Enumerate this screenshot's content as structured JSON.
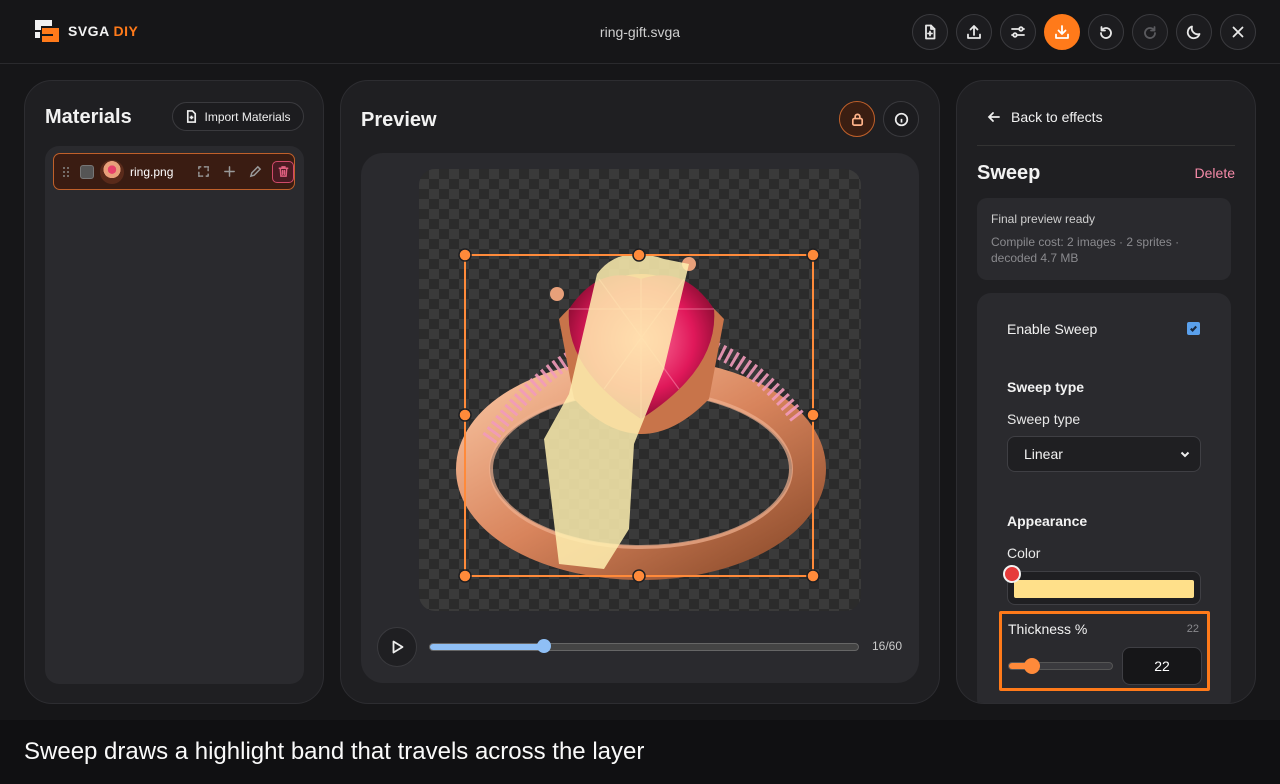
{
  "app": {
    "logo_primary": "SVGA",
    "logo_accent": "DIY",
    "file_name": "ring-gift.svga",
    "accent_color": "#ff7a1a"
  },
  "toolbar": {
    "buttons": [
      {
        "name": "new-file",
        "icon": "file-plus-icon"
      },
      {
        "name": "upload",
        "icon": "upload-icon"
      },
      {
        "name": "settings",
        "icon": "sliders-icon"
      },
      {
        "name": "download",
        "icon": "download-icon",
        "primary": true
      },
      {
        "name": "undo",
        "icon": "undo-icon"
      },
      {
        "name": "redo",
        "icon": "redo-icon",
        "disabled": true
      },
      {
        "name": "theme",
        "icon": "moon-icon"
      },
      {
        "name": "close",
        "icon": "close-icon"
      }
    ]
  },
  "materials": {
    "title": "Materials",
    "import_label": "Import Materials",
    "items": [
      {
        "name": "ring.png",
        "selected": true
      }
    ]
  },
  "preview": {
    "title": "Preview",
    "current_frame": 16,
    "total_frames": 60,
    "frame_readout": "16/60"
  },
  "effects": {
    "back_label": "Back to effects",
    "effect_title": "Sweep",
    "delete_label": "Delete",
    "status_title": "Final preview ready",
    "status_detail": "Compile cost: 2 images · 2 sprites · decoded 4.7 MB",
    "enable_label": "Enable Sweep",
    "enabled": true,
    "type_section": "Sweep type",
    "type_label": "Sweep type",
    "type_value": "Linear",
    "appearance_section": "Appearance",
    "color_label": "Color",
    "color_value": "#ffe08a",
    "thickness_label": "Thickness %",
    "thickness_value": "22",
    "thickness_max": 100
  },
  "caption": "Sweep draws a highlight band that travels across the layer"
}
